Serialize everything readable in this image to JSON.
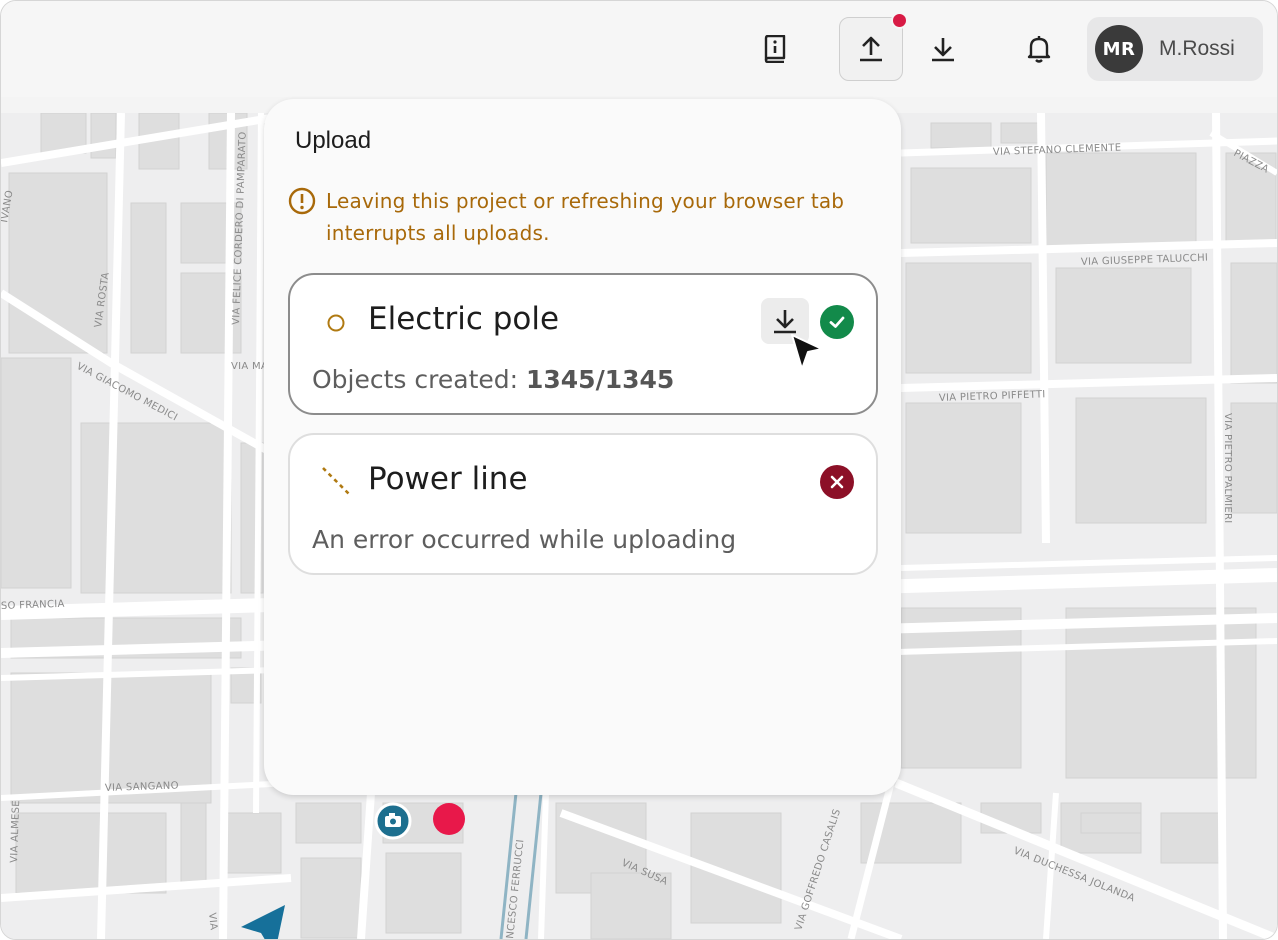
{
  "header": {
    "icons": [
      "info-book-icon",
      "upload-icon",
      "download-icon",
      "bell-icon"
    ],
    "upload_has_notification": true,
    "user": {
      "initials": "MR",
      "name": "M.Rossi"
    }
  },
  "upload_panel": {
    "title": "Upload",
    "warning": "Leaving this project or refreshing your browser tab interrupts all uploads.",
    "items": [
      {
        "name": "Electric pole",
        "geometry_icon": "point-icon",
        "label": "Objects created:",
        "count": "1345/1345",
        "status": "success"
      },
      {
        "name": "Power line",
        "geometry_icon": "dashed-line-icon",
        "message": "An error occurred while uploading",
        "status": "error"
      }
    ]
  },
  "map": {
    "streets": [
      "VIA STEFANO CLEMENTE",
      "PIAZZA",
      "VIA GIUSEPPE TALUCCHI",
      "VIA PIETRO PIFFETTI",
      "VIA PIETRO PALMIERI",
      "VIA ROSTA",
      "VIA FELICE CORDERO DI PAMPARATO",
      "VIA GIACOMO MEDICI",
      "VIA MA",
      "SO FRANCIA",
      "VIA SANGANO",
      "VIA ALMESE",
      "VIA SUSA",
      "VIA GOFFREDO CASALIS",
      "VIA DUCHESSA JOLANDA",
      "NCESCO FERRUCCI",
      "VIA",
      "IVANO"
    ]
  },
  "colors": {
    "warning": "#a8690a",
    "success": "#128a4a",
    "error": "#8c1027",
    "notification": "#d81b45",
    "camera_marker": "#1d6f8f",
    "red_marker": "#e8184a"
  }
}
